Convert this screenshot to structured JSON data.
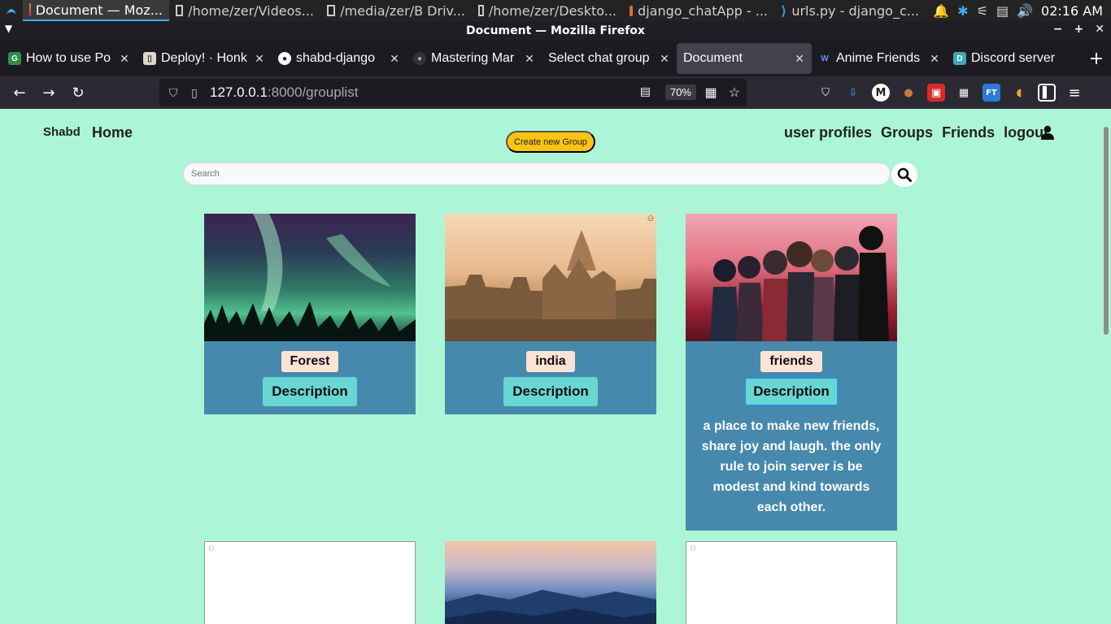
{
  "taskbar": {
    "tasks": [
      {
        "label": "Document — Moz...",
        "active": true
      },
      {
        "label": "/home/zer/Videos..."
      },
      {
        "label": "/media/zer/B Driv..."
      },
      {
        "label": "/home/zer/Deskto..."
      },
      {
        "label": "django_chatApp - ..."
      },
      {
        "label": "urls.py - django_c..."
      }
    ],
    "time": "02:16 AM"
  },
  "window": {
    "title": "Document — Mozilla Firefox"
  },
  "tabs": [
    {
      "label": "How to use Po",
      "icon": "gfg-icon"
    },
    {
      "label": "Deploy! · Honk",
      "icon": "book-icon"
    },
    {
      "label": "shabd-django",
      "icon": "github-icon"
    },
    {
      "label": "Mastering Mar",
      "icon": "github-icon"
    },
    {
      "label": "Select chat group",
      "icon": ""
    },
    {
      "label": "Document",
      "icon": "",
      "active": true
    },
    {
      "label": "Anime Friends",
      "icon": "w-icon"
    },
    {
      "label": "Discord server",
      "icon": "discord-icon"
    }
  ],
  "url": {
    "host": "127.0.0.1",
    "path": ":8000/grouplist",
    "zoom": "70%"
  },
  "site": {
    "brand": "Shabd",
    "home": "Home",
    "create_button": "Create new Group",
    "nav": [
      "user profiles",
      "Groups",
      "Friends",
      "logout"
    ],
    "search_placeholder": "Search"
  },
  "groups": [
    {
      "name": "Forest",
      "button": "Description",
      "description": ""
    },
    {
      "name": "india",
      "button": "Description",
      "description": ""
    },
    {
      "name": "friends",
      "button": "Description",
      "description": "a place to make new friends, share joy and laugh. the only rule to join server is be modest and kind towards each other."
    }
  ],
  "colors": {
    "page_bg": "#adf5d7",
    "card_bg": "#4689ad",
    "button_bg": "#68d6d2",
    "create_btn": "#f8c311"
  }
}
